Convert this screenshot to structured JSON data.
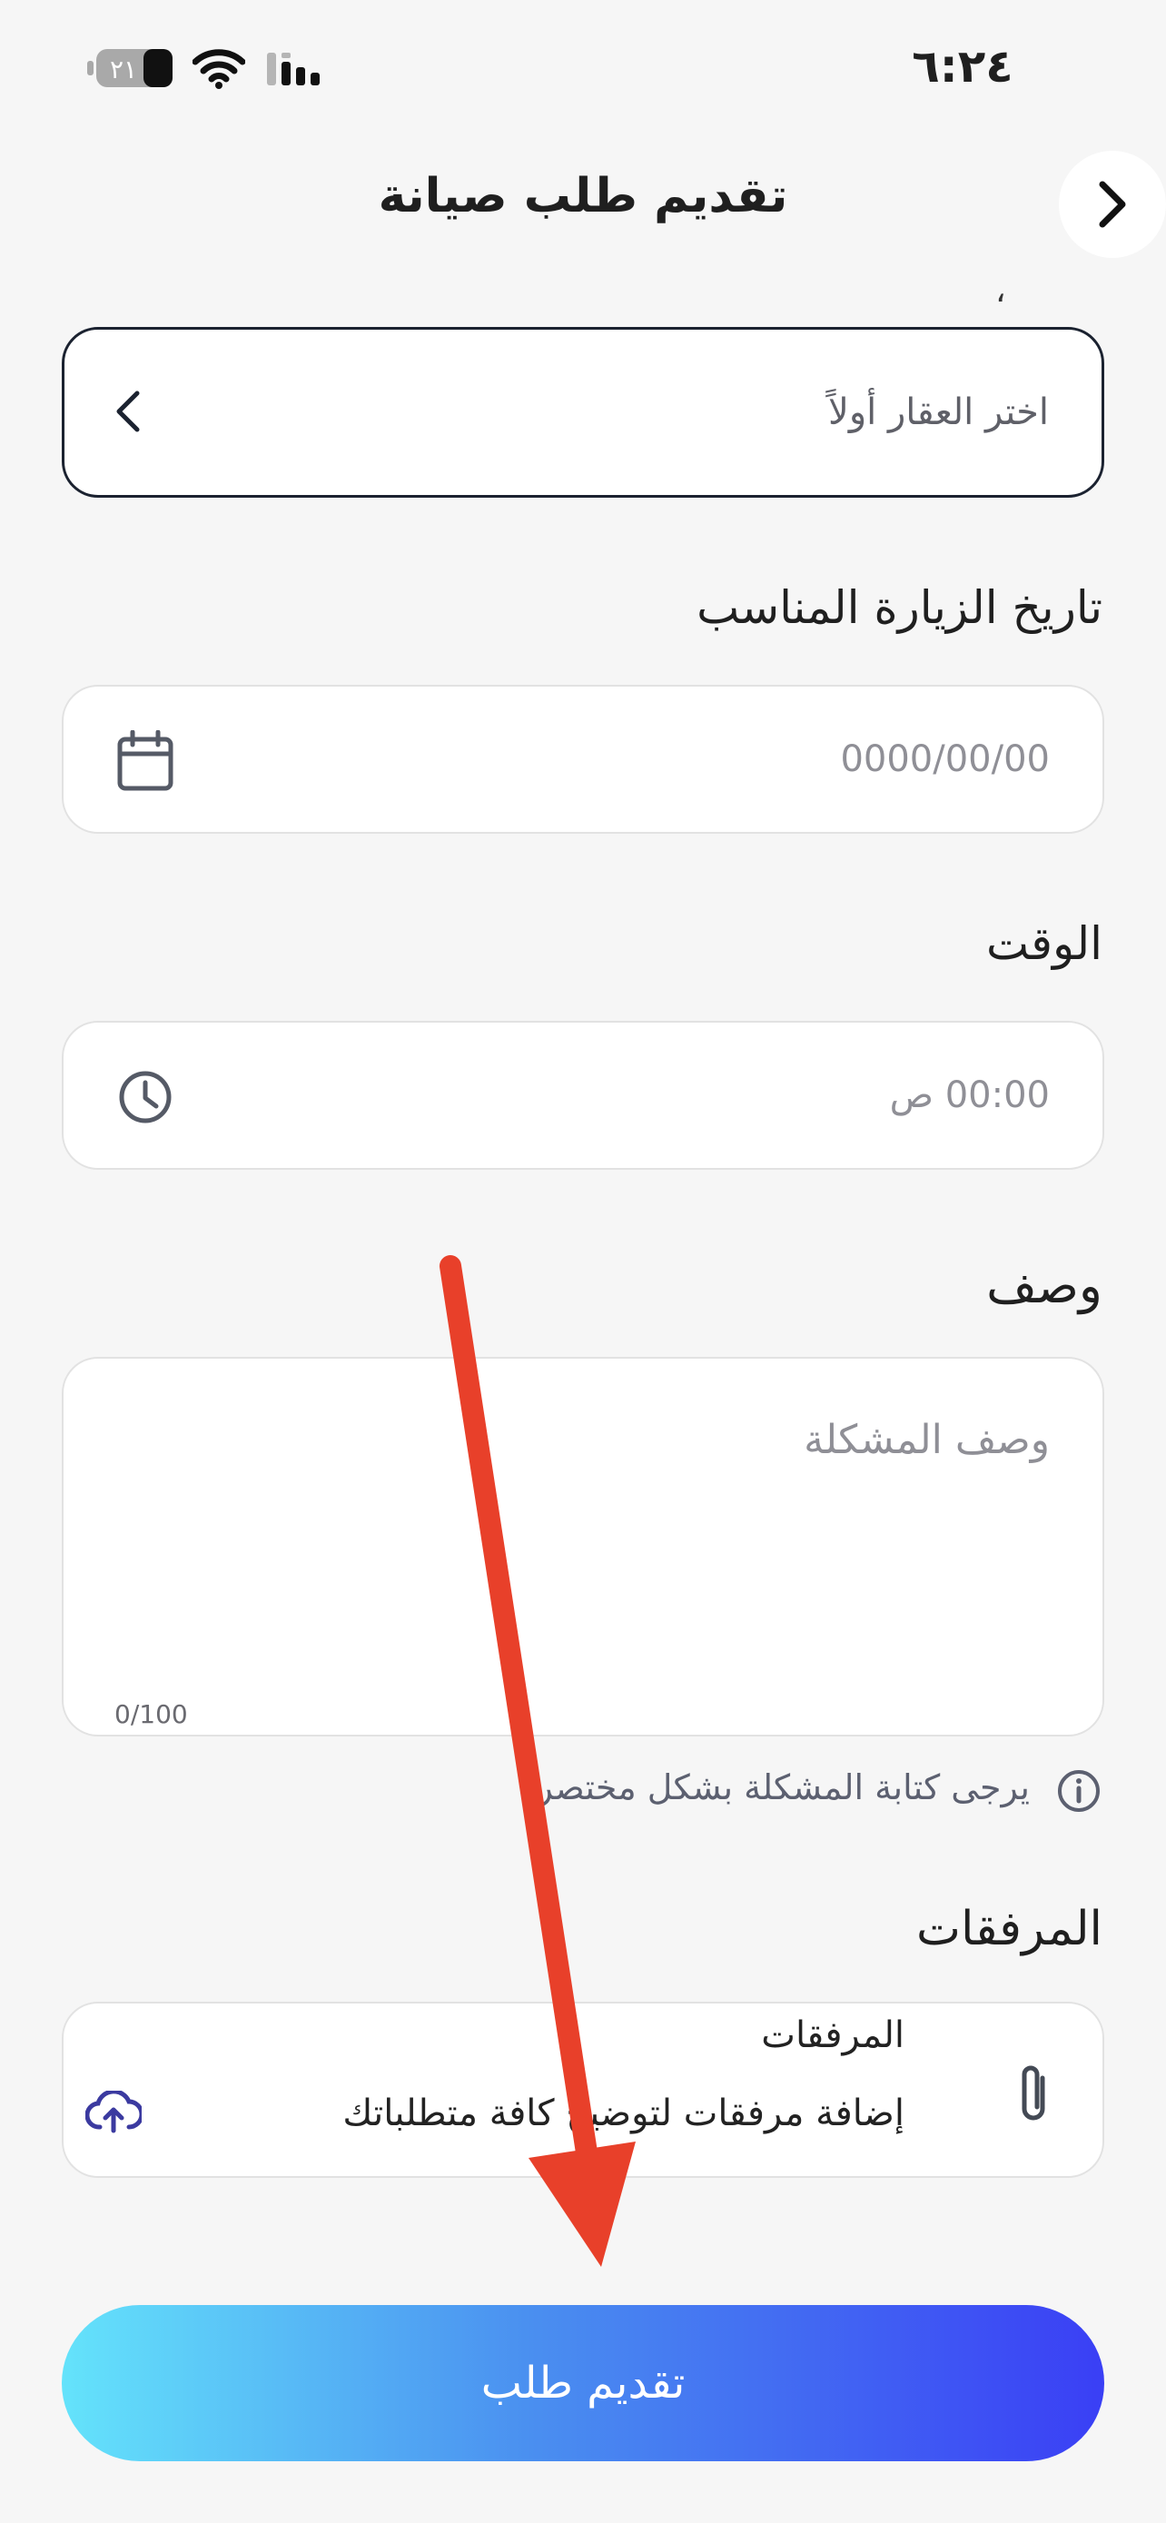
{
  "status_bar": {
    "time": "٦:٢٤",
    "battery": "٢١"
  },
  "header": {
    "title": "تقديم طلب صيانة",
    "partial_mark": "،"
  },
  "property_select": {
    "placeholder": "اختر العقار أولاً"
  },
  "visit_date": {
    "label": "تاريخ الزيارة المناسب",
    "placeholder": "0000/00/00"
  },
  "time_field": {
    "label": "الوقت",
    "placeholder": "00:00 ص"
  },
  "description": {
    "label": "وصف",
    "placeholder": "وصف المشكلة",
    "counter": "0/100",
    "hint": "يرجى كتابة المشكلة بشكل مختصر"
  },
  "attachments": {
    "label": "المرفقات",
    "box_title": "المرفقات",
    "box_subtitle": "إضافة مرفقات لتوضيح كافة متطلباتك"
  },
  "submit": {
    "label": "تقديم طلب"
  },
  "colors": {
    "background": "#f6f6f6",
    "gradient_start": "#64e3fb",
    "gradient_end": "#3a3ff5",
    "arrow": "#e8402a",
    "upload_icon": "#3b3aa0"
  }
}
